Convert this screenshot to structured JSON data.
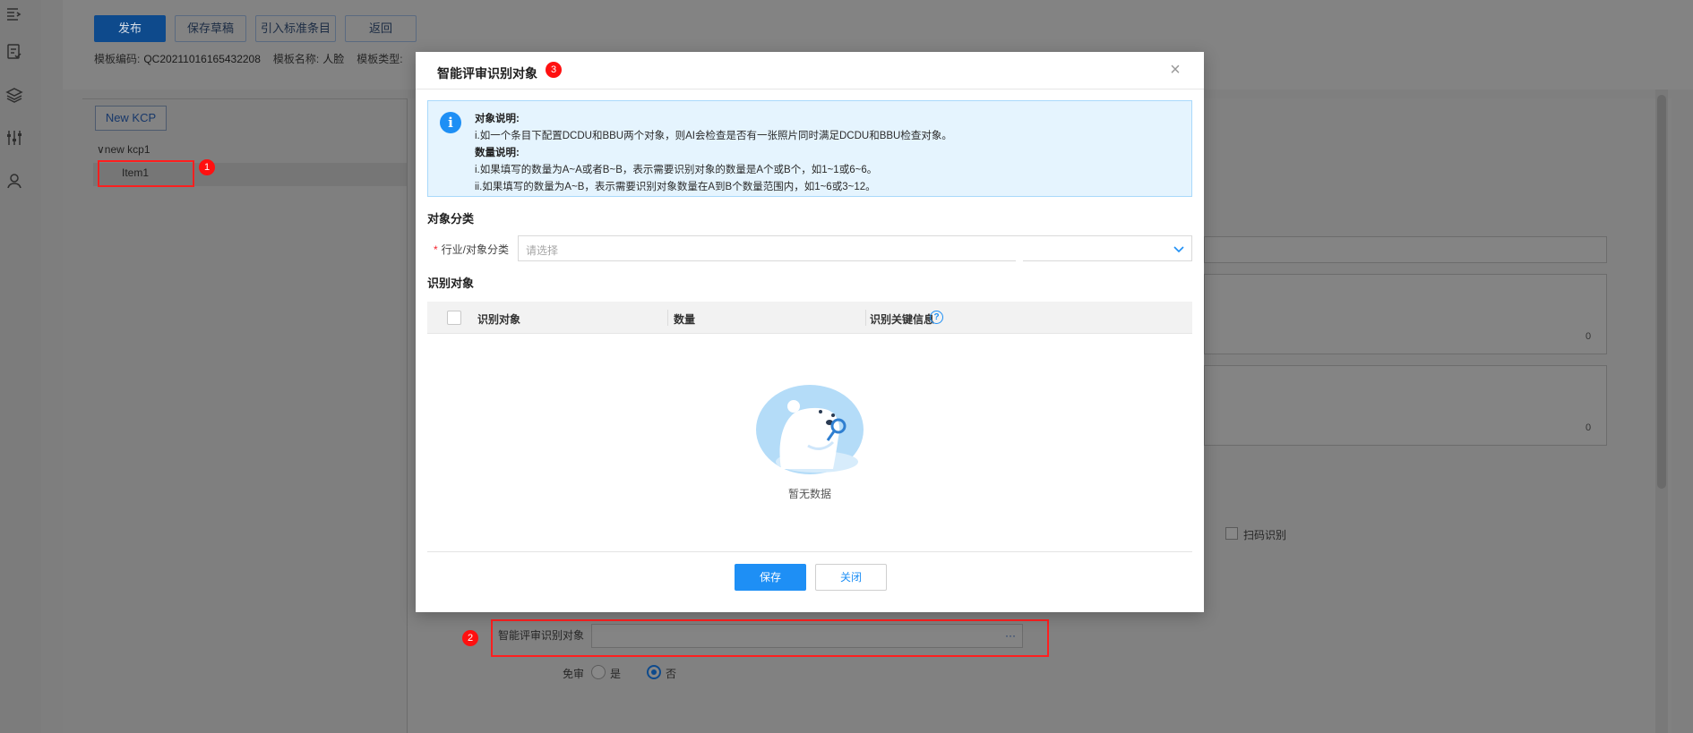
{
  "toolbar": {
    "publish": "发布",
    "save_draft": "保存草稿",
    "import_std": "引入标准条目",
    "back": "返回"
  },
  "meta": {
    "code_label": "模板编码:",
    "code_value": "QC20211016165432208",
    "name_label": "模板名称:",
    "name_value": "人脸",
    "type_label": "模板类型:"
  },
  "tree": {
    "new_kcp": "New KCP",
    "node": "new kcp1",
    "item": "Item1"
  },
  "background_form": {
    "count1": "0",
    "count2": "0",
    "scan_label": "扫码识别",
    "recog_label": "智能评审识别对象",
    "recog_dots": "···",
    "exempt_label": "免审",
    "yes": "是",
    "no": "否"
  },
  "annotations": {
    "b1": "1",
    "b2": "2",
    "b3": "3"
  },
  "modal": {
    "title": "智能评审识别对象",
    "info": {
      "h1": "对象说明:",
      "l1": "i.如一个条目下配置DCDU和BBU两个对象，则AI会检查是否有一张照片同时满足DCDU和BBU检查对象。",
      "h2": "数量说明:",
      "l2": "i.如果填写的数量为A~A或者B~B，表示需要识别对象的数量是A个或B个，如1~1或6~6。",
      "l3": "ii.如果填写的数量为A~B，表示需要识别对象数量在A到B个数量范围内，如1~6或3~12。"
    },
    "section_category": "对象分类",
    "category_label": "行业/对象分类",
    "category_required": "*",
    "category_placeholder": "请选择",
    "section_objects": "识别对象",
    "columns": [
      "识别对象",
      "数量",
      "识别关键信息"
    ],
    "empty_text": "暂无数据",
    "save": "保存",
    "close": "关闭"
  },
  "colors": {
    "primary": "#1e8ff5",
    "annotation_red": "#ff1f1f"
  }
}
